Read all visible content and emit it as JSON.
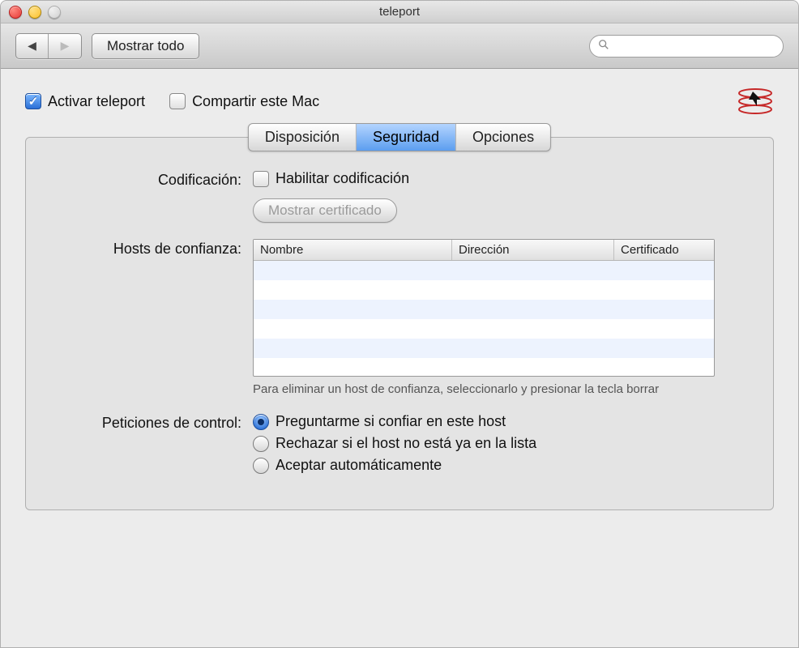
{
  "window": {
    "title": "teleport"
  },
  "toolbar": {
    "show_all": "Mostrar todo",
    "search_placeholder": ""
  },
  "top": {
    "activate_label": "Activar teleport",
    "activate_checked": true,
    "share_label": "Compartir este Mac",
    "share_checked": false
  },
  "tabs": {
    "layout": "Disposición",
    "security": "Seguridad",
    "options": "Opciones",
    "selected": "security"
  },
  "encoding": {
    "label": "Codificación:",
    "enable_label": "Habilitar codificación",
    "enable_checked": false,
    "show_cert_button": "Mostrar certificado"
  },
  "trusted_hosts": {
    "label": "Hosts de confianza:",
    "columns": {
      "name": "Nombre",
      "address": "Dirección",
      "certificate": "Certificado"
    },
    "rows": [],
    "hint": "Para eliminar un host de confianza, seleccionarlo y presionar la tecla borrar"
  },
  "control_requests": {
    "label": "Peticiones de control:",
    "options": [
      "Preguntarme si confiar en este host",
      "Rechazar si el host no está ya en la lista",
      "Aceptar automáticamente"
    ],
    "selected_index": 0
  }
}
